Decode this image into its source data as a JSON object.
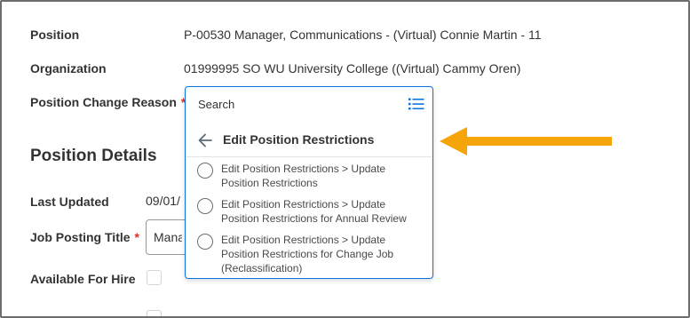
{
  "form": {
    "position_label": "Position",
    "position_value": "P-00530 Manager, Communications - (Virtual) Connie Martin - 11",
    "organization_label": "Organization",
    "organization_value": "01999995 SO WU University College ((Virtual) Cammy Oren)",
    "change_reason_label": "Position Change Reason",
    "required_marker": "*"
  },
  "details": {
    "section_title": "Position Details",
    "last_updated_label": "Last Updated",
    "last_updated_value": "09/01/",
    "job_posting_title_label": "Job Posting Title",
    "job_posting_title_value": "Mana",
    "available_for_hire_label": "Available For Hire"
  },
  "dropdown": {
    "search_placeholder": "Search",
    "list_icon": "list-view-icon",
    "back_icon": "arrow-left-icon",
    "heading": "Edit Position Restrictions",
    "options": [
      {
        "line1": "Edit Position Restrictions > Update",
        "line2": "Position Restrictions",
        "line3": ""
      },
      {
        "line1": "Edit Position Restrictions > Update",
        "line2": "Position Restrictions for Annual Review",
        "line3": ""
      },
      {
        "line1": "Edit Position Restrictions > Update",
        "line2": "Position Restrictions for Change Job",
        "line3": "(Reclassification)"
      }
    ]
  },
  "colors": {
    "accent": "#0875e1",
    "required": "#de2e21",
    "annotation_arrow": "#f5a50a"
  }
}
